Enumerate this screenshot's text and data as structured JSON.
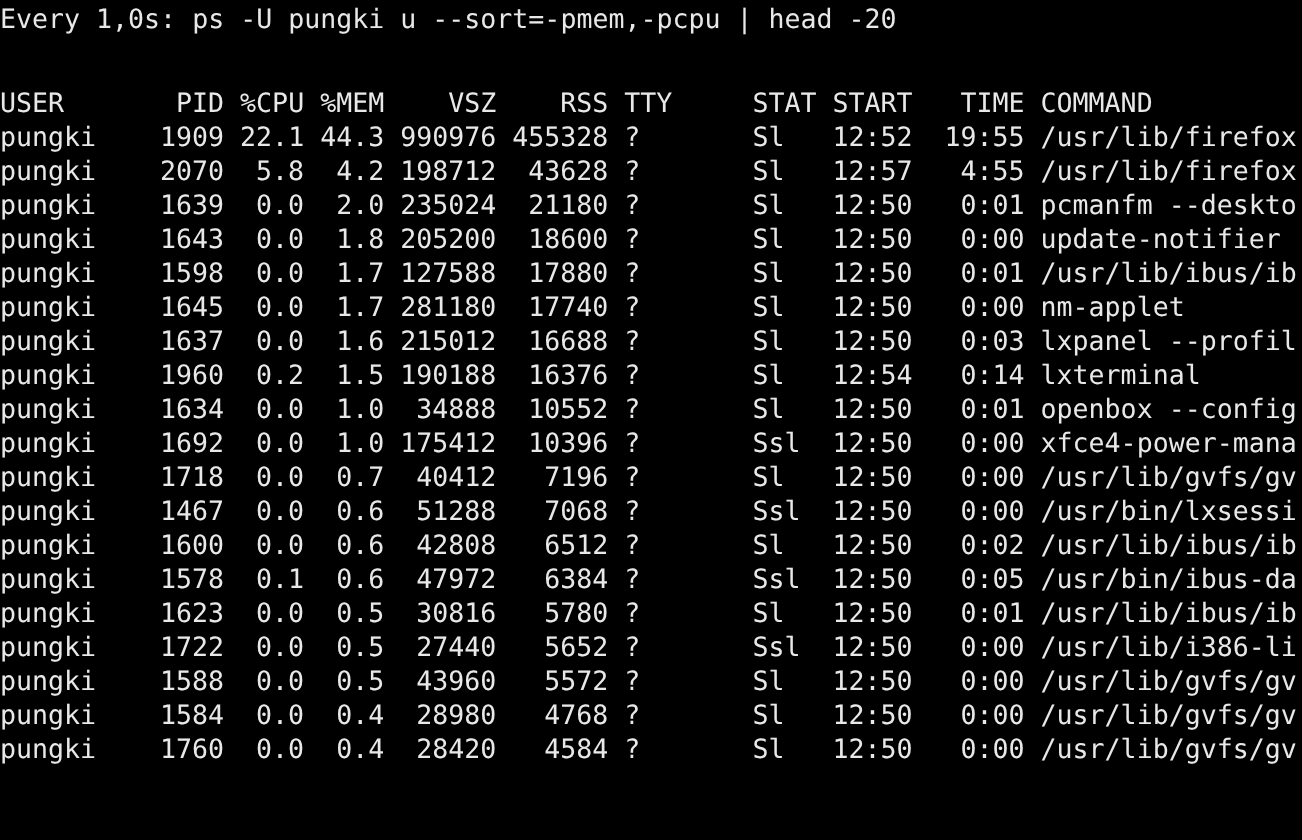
{
  "watch_header": "Every 1,0s: ps -U pungki u --sort=-pmem,-pcpu | head -20",
  "table": {
    "columns": [
      "USER",
      "PID",
      "%CPU",
      "%MEM",
      "VSZ",
      "RSS",
      "TTY",
      "STAT",
      "START",
      "TIME",
      "COMMAND"
    ],
    "rows": [
      [
        "pungki",
        "1909",
        "22.1",
        "44.3",
        "990976",
        "455328",
        "?",
        "Sl",
        "12:52",
        "19:55",
        "/usr/lib/firefox"
      ],
      [
        "pungki",
        "2070",
        "5.8",
        "4.2",
        "198712",
        "43628",
        "?",
        "Sl",
        "12:57",
        "4:55",
        "/usr/lib/firefox"
      ],
      [
        "pungki",
        "1639",
        "0.0",
        "2.0",
        "235024",
        "21180",
        "?",
        "Sl",
        "12:50",
        "0:01",
        "pcmanfm --deskto"
      ],
      [
        "pungki",
        "1643",
        "0.0",
        "1.8",
        "205200",
        "18600",
        "?",
        "Sl",
        "12:50",
        "0:00",
        "update-notifier"
      ],
      [
        "pungki",
        "1598",
        "0.0",
        "1.7",
        "127588",
        "17880",
        "?",
        "Sl",
        "12:50",
        "0:01",
        "/usr/lib/ibus/ib"
      ],
      [
        "pungki",
        "1645",
        "0.0",
        "1.7",
        "281180",
        "17740",
        "?",
        "Sl",
        "12:50",
        "0:00",
        "nm-applet"
      ],
      [
        "pungki",
        "1637",
        "0.0",
        "1.6",
        "215012",
        "16688",
        "?",
        "Sl",
        "12:50",
        "0:03",
        "lxpanel --profil"
      ],
      [
        "pungki",
        "1960",
        "0.2",
        "1.5",
        "190188",
        "16376",
        "?",
        "Sl",
        "12:54",
        "0:14",
        "lxterminal"
      ],
      [
        "pungki",
        "1634",
        "0.0",
        "1.0",
        "34888",
        "10552",
        "?",
        "Sl",
        "12:50",
        "0:01",
        "openbox --config"
      ],
      [
        "pungki",
        "1692",
        "0.0",
        "1.0",
        "175412",
        "10396",
        "?",
        "Ssl",
        "12:50",
        "0:00",
        "xfce4-power-mana"
      ],
      [
        "pungki",
        "1718",
        "0.0",
        "0.7",
        "40412",
        "7196",
        "?",
        "Sl",
        "12:50",
        "0:00",
        "/usr/lib/gvfs/gv"
      ],
      [
        "pungki",
        "1467",
        "0.0",
        "0.6",
        "51288",
        "7068",
        "?",
        "Ssl",
        "12:50",
        "0:00",
        "/usr/bin/lxsessi"
      ],
      [
        "pungki",
        "1600",
        "0.0",
        "0.6",
        "42808",
        "6512",
        "?",
        "Sl",
        "12:50",
        "0:02",
        "/usr/lib/ibus/ib"
      ],
      [
        "pungki",
        "1578",
        "0.1",
        "0.6",
        "47972",
        "6384",
        "?",
        "Ssl",
        "12:50",
        "0:05",
        "/usr/bin/ibus-da"
      ],
      [
        "pungki",
        "1623",
        "0.0",
        "0.5",
        "30816",
        "5780",
        "?",
        "Sl",
        "12:50",
        "0:01",
        "/usr/lib/ibus/ib"
      ],
      [
        "pungki",
        "1722",
        "0.0",
        "0.5",
        "27440",
        "5652",
        "?",
        "Ssl",
        "12:50",
        "0:00",
        "/usr/lib/i386-li"
      ],
      [
        "pungki",
        "1588",
        "0.0",
        "0.5",
        "43960",
        "5572",
        "?",
        "Sl",
        "12:50",
        "0:00",
        "/usr/lib/gvfs/gv"
      ],
      [
        "pungki",
        "1584",
        "0.0",
        "0.4",
        "28980",
        "4768",
        "?",
        "Sl",
        "12:50",
        "0:00",
        "/usr/lib/gvfs/gv"
      ],
      [
        "pungki",
        "1760",
        "0.0",
        "0.4",
        "28420",
        "4584",
        "?",
        "Sl",
        "12:50",
        "0:00",
        "/usr/lib/gvfs/gv"
      ]
    ]
  }
}
